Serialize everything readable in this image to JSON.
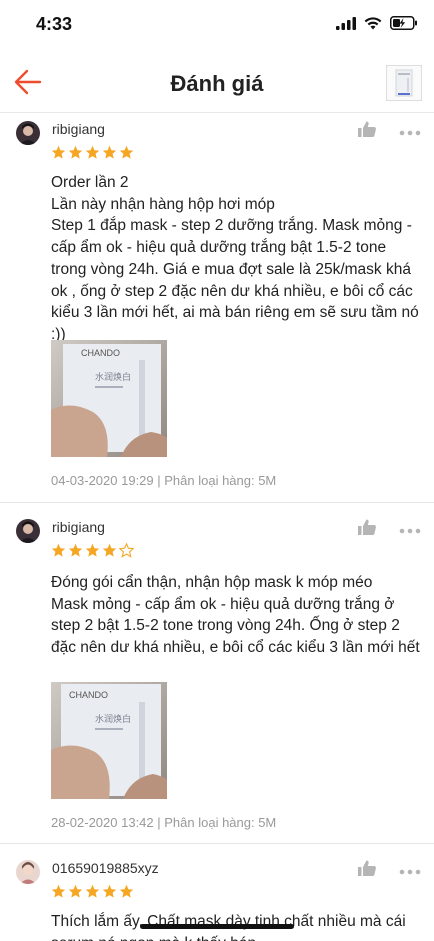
{
  "status": {
    "time": "4:33"
  },
  "header": {
    "title": "Đánh giá"
  },
  "reviews": [
    {
      "username": "ribigiang",
      "rating": 5,
      "text": "Order lần 2\nLần này nhận hàng hộp hơi móp\nStep 1 đắp mask - step 2 dưỡng trắng. Mask mỏng - cấp ẩm ok - hiệu quả dưỡng trắng bật 1.5-2 tone trong vòng 24h. Giá e mua đợt sale là 25k/mask khá ok , ống ở step 2 đặc nên dư khá nhiều, e bôi cổ các kiểu 3 lần mới hết, ai mà bán riêng em sẽ sưu tầm nó :))",
      "meta": "04-03-2020 19:29 | Phân loại hàng: 5M"
    },
    {
      "username": "ribigiang",
      "rating": 4,
      "text": "Đóng gói cẩn thận, nhận hộp mask k móp méo\nMask mỏng - cấp ẩm ok - hiệu quả dưỡng trắng ở step 2 bật 1.5-2 tone trong vòng 24h. Ống ở step 2 đặc nên dư khá nhiều, e bôi cổ các kiểu 3 lần mới hết",
      "meta": "28-02-2020 13:42 | Phân loại hàng: 5M"
    },
    {
      "username": "01659019885xyz",
      "rating": 5,
      "text": "Thích lắm ấy. Chất mask dày tinh chất nhiều mà cái serum nó ngon mà k thấy bán",
      "meta": ""
    }
  ],
  "photo": {
    "brand": "CHANDO",
    "cn_text": "水润焕白"
  },
  "colors": {
    "accent": "#ee4d2d",
    "star": "#f5a623",
    "muted": "#999999"
  }
}
